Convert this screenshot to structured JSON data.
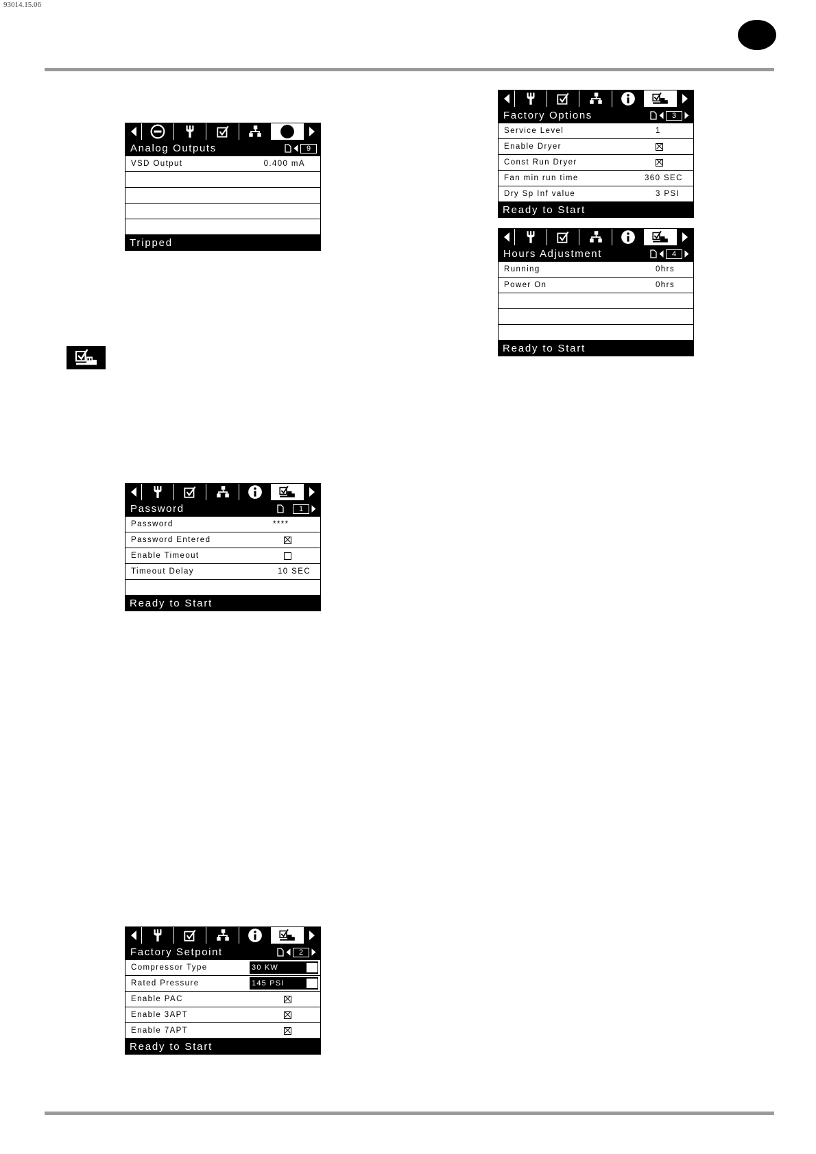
{
  "page": {
    "doc_code": "93014.15.06"
  },
  "icons": {
    "left_arrow": "left-arrow-icon",
    "right_arrow": "right-arrow-icon",
    "stop": "stop-icon",
    "wrench": "wrench-icon",
    "checklist": "checklist-icon",
    "network": "network-icon",
    "info": "info-icon",
    "factory": "factory-settings-icon",
    "page": "page-icon"
  },
  "panels": {
    "analog_outputs": {
      "title": "Analog Outputs",
      "page_no": "9",
      "rows": [
        {
          "label": "VSD Output",
          "value": "0.400 mA"
        }
      ],
      "status": "Tripped"
    },
    "password": {
      "title": "Password",
      "page_no": "1",
      "rows": [
        {
          "label": "Password",
          "value": "****"
        },
        {
          "label": "Password Entered",
          "checked": true
        },
        {
          "label": "Enable Timeout",
          "checked": false
        },
        {
          "label": "Timeout Delay",
          "value": "10 SEC"
        }
      ],
      "status": "Ready to Start"
    },
    "factory_setpoint": {
      "title": "Factory Setpoint",
      "page_no": "2",
      "rows": [
        {
          "label": "Compressor Type",
          "value": "30 KW"
        },
        {
          "label": "Rated Pressure",
          "value": "145 PSI"
        },
        {
          "label": "Enable PAC",
          "checked": true
        },
        {
          "label": "Enable 3APT",
          "checked": true
        },
        {
          "label": "Enable 7APT",
          "checked": true
        }
      ],
      "status": "Ready to Start"
    },
    "factory_options": {
      "title": "Factory Options",
      "page_no": "3",
      "rows": [
        {
          "label": "Service Level",
          "value": "1"
        },
        {
          "label": "Enable Dryer",
          "checked": true
        },
        {
          "label": "Const Run Dryer",
          "checked": true
        },
        {
          "label": "Fan min run time",
          "value": "360 SEC"
        },
        {
          "label": "Dry Sp Inf value",
          "value": "3 PSI"
        }
      ],
      "status": "Ready to Start"
    },
    "hours_adjustment": {
      "title": "Hours Adjustment",
      "page_no": "4",
      "rows": [
        {
          "label": "Running",
          "value": "0hrs"
        },
        {
          "label": "Power On",
          "value": "0hrs"
        }
      ],
      "status": "Ready to Start"
    }
  }
}
